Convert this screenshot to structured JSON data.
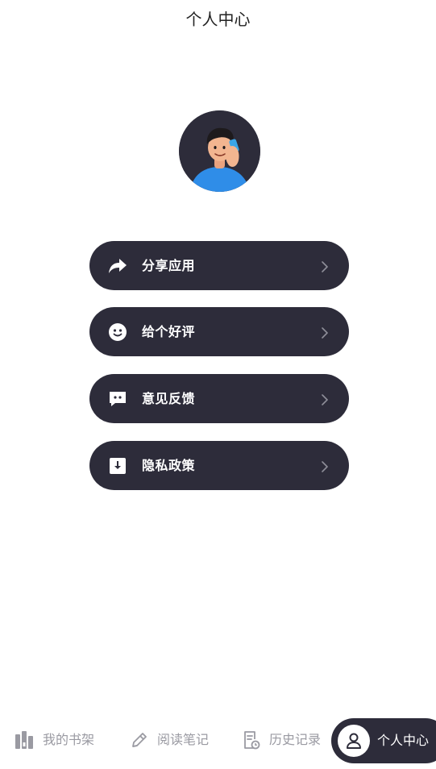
{
  "header": {
    "title": "个人中心"
  },
  "profile": {
    "avatar_icon": "user-avatar-3d-man-on-phone"
  },
  "menu": {
    "items": [
      {
        "label": "分享应用",
        "icon": "share-arrow-icon"
      },
      {
        "label": "给个好评",
        "icon": "smile-icon"
      },
      {
        "label": "意见反馈",
        "icon": "feedback-chat-icon"
      },
      {
        "label": "隐私政策",
        "icon": "privacy-download-icon"
      }
    ]
  },
  "tabbar": {
    "tabs": [
      {
        "label": "我的书架",
        "icon": "bookshelf-icon",
        "active": false
      },
      {
        "label": "阅读笔记",
        "icon": "pencil-icon",
        "active": false
      },
      {
        "label": "历史记录",
        "icon": "history-icon",
        "active": false
      },
      {
        "label": "个人中心",
        "icon": "person-icon",
        "active": true
      }
    ]
  },
  "colors": {
    "dark": "#2d2c3a",
    "inactive_tab": "#9a9aa2",
    "background": "#ffffff"
  }
}
